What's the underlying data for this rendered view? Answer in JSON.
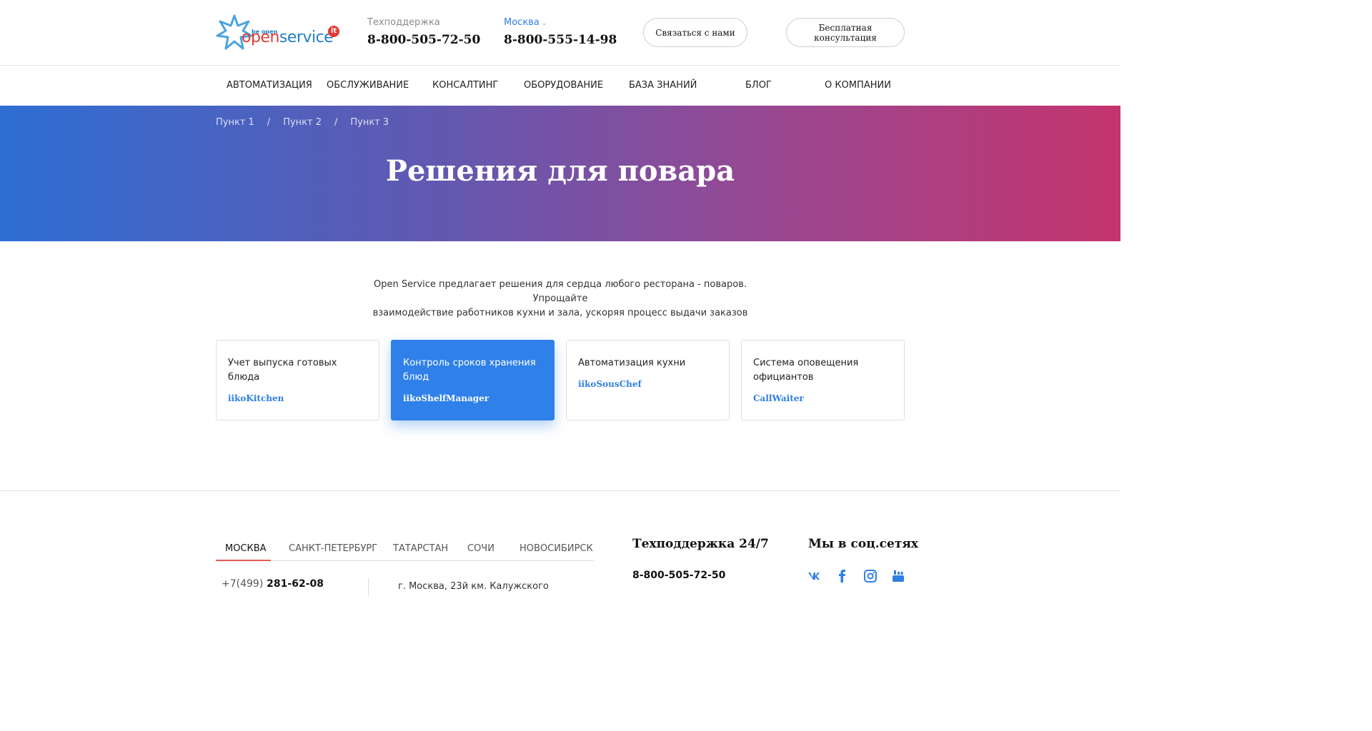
{
  "header": {
    "logo": {
      "tagline": "be open",
      "brand_open": "open",
      "brand_service": "service",
      "badge": "it"
    },
    "support_label": "Техподдержка",
    "support_phone": "8-800-505-72-50",
    "city": "Москва",
    "city_phone": "8-800-555-14-98",
    "contact_button": "Связаться с нами",
    "consult_button": "Бесплатная консультация"
  },
  "nav": {
    "items": [
      "Автоматизация",
      "Обслуживание",
      "Консалтинг",
      "Оборудование",
      "База знаний",
      "Блог",
      "О компании"
    ]
  },
  "hero": {
    "breadcrumb": [
      "Пункт 1",
      "/",
      "Пункт 2",
      "/",
      "Пункт 3"
    ],
    "title": "Решения для повара"
  },
  "intro": {
    "line1": "Open Service предлагает решения для сердца любого ресторана - поваров. Упрощайте",
    "line2": "взаимодействие работников кухни и зала, ускоряя процесс выдачи заказов"
  },
  "cards": [
    {
      "title": "Учет выпуска готовых блюда",
      "product": "iikoKitchen",
      "active": false
    },
    {
      "title": "Контроль сроков хранения блюд",
      "product": "iikoShelfManager",
      "active": true
    },
    {
      "title": "Автоматизация кухни",
      "product": "iikoSousChef",
      "active": false
    },
    {
      "title": "Система оповещения официантов",
      "product": "CallWaiter",
      "active": false
    }
  ],
  "footer": {
    "tabs": [
      "Москва",
      "Санкт-Петербург",
      "Татарстан",
      "Сочи",
      "Новосибирск"
    ],
    "active_tab": "Москва",
    "phone_code": "+7(499)",
    "phone_number": " 281-62-08",
    "address": "г. Москва, 23й км. Калужского",
    "support_heading": "Техподдержка 24/7",
    "support_phone": "8-800-505-72-50",
    "social_heading": "Мы в соц.сетях",
    "social": [
      "vk-icon",
      "facebook-icon",
      "instagram-icon",
      "youtube-icon"
    ]
  },
  "colors": {
    "accent_blue": "#2f80e8",
    "gradient_start": "#2e6ed3",
    "gradient_end": "#c4346e",
    "tab_underline": "#e35b52"
  }
}
